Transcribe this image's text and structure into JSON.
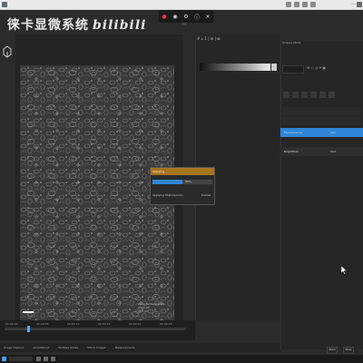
{
  "titlebar": {
    "clock": "...",
    "icons": [
      "wifi-icon",
      "volume-icon",
      "battery-icon",
      "ime-icon"
    ]
  },
  "toolbar": {
    "icons": [
      "record-icon",
      "camera-icon",
      "settings-icon",
      "info-icon",
      "close-icon"
    ]
  },
  "watermark": {
    "text": "徕卡显微系统",
    "logo": "bilibili"
  },
  "mid_panel": {
    "tabs_label": "# ⌂ 1 | ⊞ | ⊠"
  },
  "image_info": {
    "lines": [
      "Leica Microsystems",
      "2022-03",
      "100 µm"
    ]
  },
  "timeline": {
    "ticks": [
      "00:00:00",
      "00:00:05",
      "00:00:10",
      "00:00:15",
      "00:00:20",
      "00:00:25"
    ]
  },
  "dialog": {
    "title": "Applying",
    "progress_percent": 50,
    "progress_label": "50%",
    "status": "Applying Post-Deconv...",
    "cancel_label": "Cancel"
  },
  "right_panel": {
    "header": "Acquire Mode",
    "row_active": {
      "label": "Fluorescence",
      "value": "Ch1"
    },
    "row_dark": {
      "label": "Brightfield",
      "value": "Ch2"
    },
    "footer_buttons": [
      "Start",
      "Stop"
    ]
  },
  "bottom_status": {
    "items": [
      "Image Capture",
      "Annotations",
      "Multiple Slides",
      "Stitch Images",
      "Measurements"
    ]
  },
  "colors": {
    "accent": "#2f86d6",
    "dialog_header": "#a8741f",
    "panel_bg": "#262626"
  }
}
